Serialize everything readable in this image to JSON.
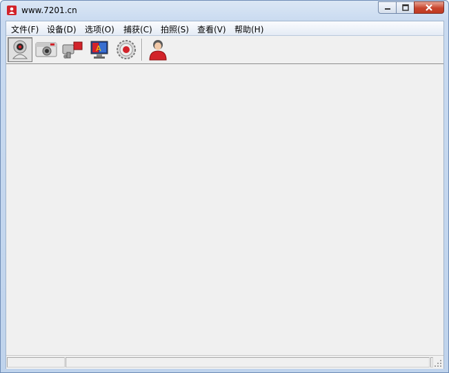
{
  "window": {
    "title": "www.7201.cn",
    "icon": "app-logo-icon",
    "accent_color": "#d2232a"
  },
  "caption_buttons": {
    "minimize_icon": "minimize-icon",
    "maximize_icon": "maximize-icon",
    "close_icon": "close-icon"
  },
  "menu": {
    "items": [
      "文件(F)",
      "设备(D)",
      "选项(O)",
      "捕获(C)",
      "拍照(S)",
      "查看(V)",
      "帮助(H)"
    ]
  },
  "toolbar": {
    "tools": [
      {
        "icon": "webcam-icon",
        "pressed": true
      },
      {
        "icon": "camera-icon",
        "pressed": false
      },
      {
        "icon": "video-camera-icon",
        "pressed": false
      },
      {
        "icon": "monitor-settings-icon",
        "pressed": false
      },
      {
        "icon": "record-gear-icon",
        "pressed": false
      },
      {
        "icon": "user-icon",
        "pressed": false
      }
    ]
  },
  "statusbar": {
    "panes": [
      "",
      "",
      ""
    ]
  }
}
